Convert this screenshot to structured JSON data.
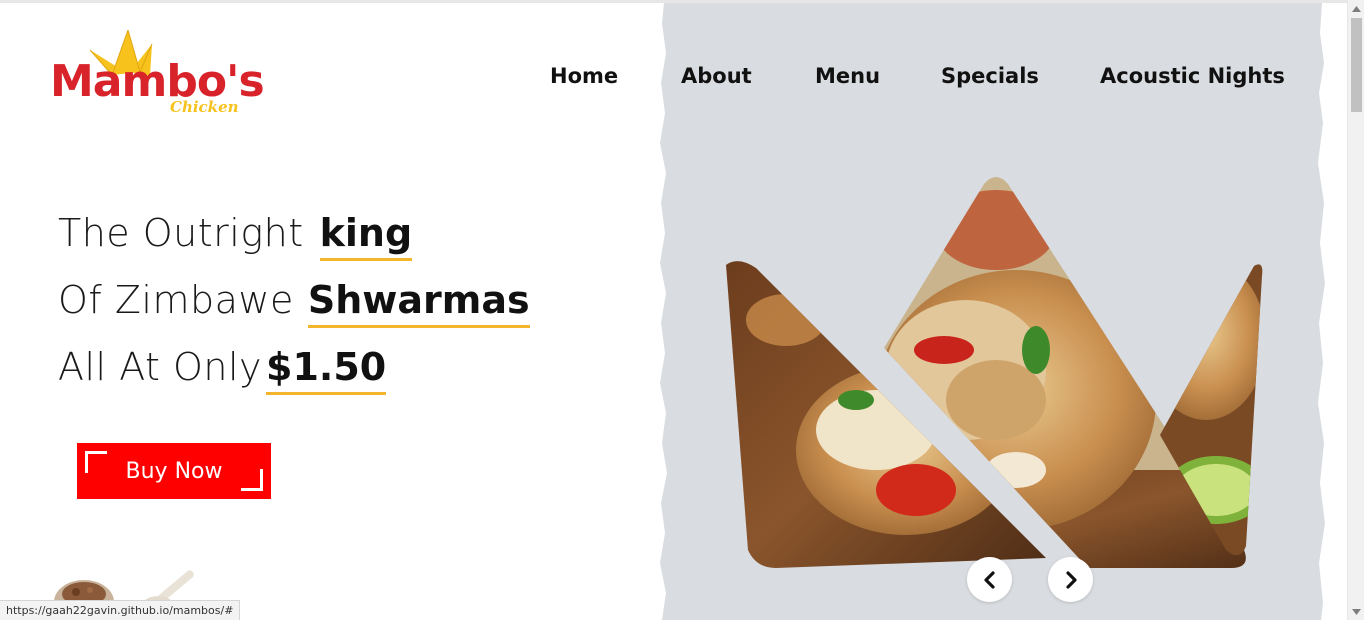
{
  "logo": {
    "wordmark": "Mambo's",
    "subtitle": "Chicken",
    "brand_red": "#d8232a",
    "brand_yellow": "#f7c21b"
  },
  "nav": {
    "items": [
      {
        "label": "Home"
      },
      {
        "label": "About"
      },
      {
        "label": "Menu"
      },
      {
        "label": "Specials"
      },
      {
        "label": "Acoustic Nights"
      }
    ]
  },
  "hero": {
    "line1_light": "The Outright",
    "line1_strong": "king",
    "line2_light": "Of Zimbawe",
    "line2_strong": "Shwarmas",
    "line3_light": "All At Only",
    "line3_strong": "$1.50",
    "underline_color": "#f3b52b"
  },
  "cta": {
    "label": "Buy Now",
    "color": "#ff0000"
  },
  "carousel": {
    "prev_icon": "chevron-left-icon",
    "next_icon": "chevron-right-icon"
  },
  "panel": {
    "color": "#d9dce0"
  },
  "status_bar": {
    "url": "https://gaah22gavin.github.io/mambos/#"
  }
}
